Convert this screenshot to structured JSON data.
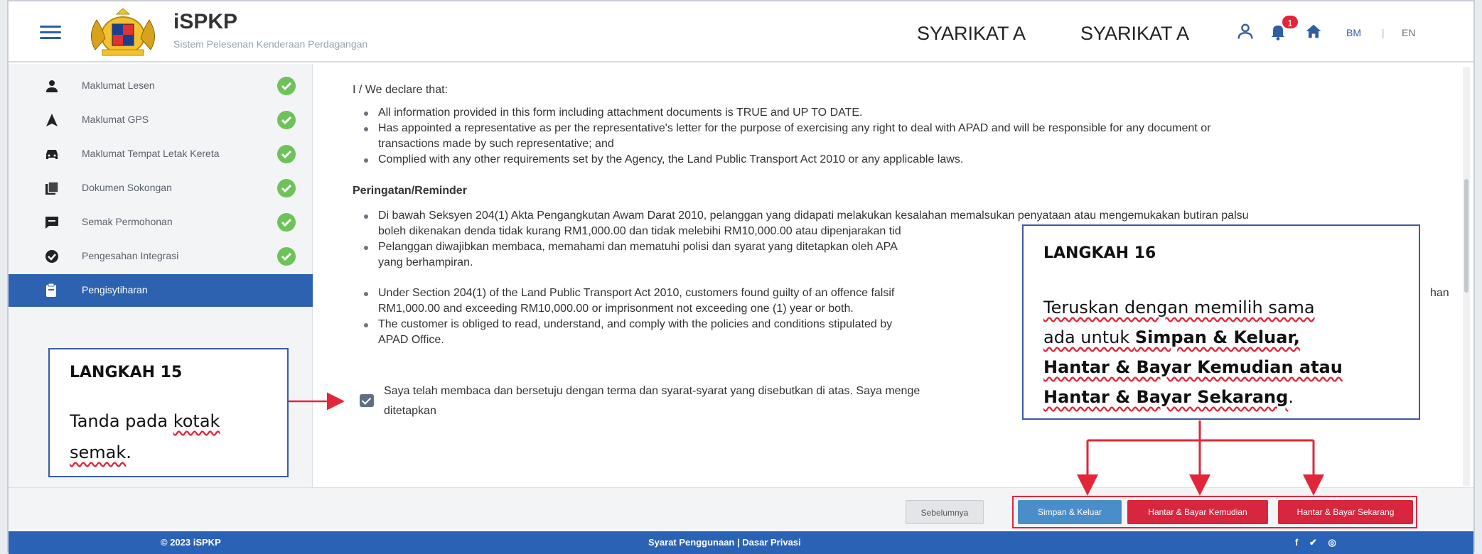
{
  "header": {
    "app_title": "iSPKP",
    "app_subtitle": "Sistem Pelesenan Kenderaan Perdagangan",
    "company_1": "SYARIKAT A",
    "company_2": "SYARIKAT A",
    "notification_count": "1",
    "lang_bm": "BM",
    "lang_sep": "|",
    "lang_en": "EN"
  },
  "sidebar": {
    "items": [
      {
        "label": "Maklumat Lesen",
        "icon": "person-icon",
        "done": true
      },
      {
        "label": "Maklumat GPS",
        "icon": "navigation-icon",
        "done": true
      },
      {
        "label": "Maklumat Tempat Letak Kereta",
        "icon": "car-icon",
        "done": true
      },
      {
        "label": "Dokumen Sokongan",
        "icon": "document-icon",
        "done": true
      },
      {
        "label": "Semak Permohonan",
        "icon": "comment-icon",
        "done": true
      },
      {
        "label": "Pengesahan Integrasi",
        "icon": "verified-icon",
        "done": true
      },
      {
        "label": "Pengisytiharan",
        "icon": "declaration-icon",
        "done": false,
        "active": true
      }
    ]
  },
  "main": {
    "declare_intro": "I / We declare that:",
    "declare_items": [
      "All information provided in this form including attachment documents is TRUE and UP TO DATE.",
      "Has appointed a representative as per the representative's letter for the purpose of exercising any right to deal with APAD and will be responsible for any document or",
      "transactions made by such representative; and",
      "Complied with any other requirements set by the Agency, the Land Public Transport Act 2010 or any applicable laws."
    ],
    "reminder_heading": "Peringatan/Reminder",
    "reminder_items": [
      "Di bawah Seksyen 204(1) Akta Pengangkutan Awam Darat 2010, pelanggan yang didapati melakukan kesalahan memalsukan penyataan atau mengemukakan butiran palsu",
      "boleh dikenakan denda tidak kurang RM1,000.00 dan tidak melebihi RM10,000.00 atau dipenjarakan tid",
      "Pelanggan diwajibkan membaca, memahami dan mematuhi polisi dan syarat yang ditetapkan oleh APA",
      "yang berhampiran.",
      "Under Section 204(1) of the Land Public Transport Act 2010, customers found guilty of an offence falsif",
      "RM1,000.00 and exceeding RM10,000.00 or imprisonment not exceeding one (1) year or both.",
      "The customer is obliged to read, understand, and comply with the policies and conditions stipulated by",
      "APAD Office.",
      "han"
    ],
    "agree_text_1": "Saya telah membaca dan bersetuju dengan terma dan syarat-syarat yang disebutkan di atas. Saya menge",
    "agree_text_2": "ditetapkan",
    "agree_checked": true
  },
  "callout_15": {
    "title": "LANGKAH 15",
    "body_1": "Tanda pada ",
    "body_2": "kotak",
    "body_3": "semak",
    "body_4": "."
  },
  "callout_16": {
    "title": "LANGKAH 16",
    "line1_a": "Teruskan dengan memilih sama",
    "line2_a": "ada untuk ",
    "line2_b": "Simpan & Keluar,",
    "line3": "Hantar & Bayar Kemudian atau",
    "line4_a": "Hantar & Bayar Sekarang",
    "line4_b": "."
  },
  "actions": {
    "prev": "Sebelumnya",
    "save": "Simpan & Keluar",
    "pay_later": "Hantar & Bayar Kemudian",
    "pay_now": "Hantar & Bayar Sekarang"
  },
  "footer": {
    "copyright": "© 2023 iSPKP",
    "terms": "Syarat Penggunaan",
    "sep": " | ",
    "privacy": "Dasar Privasi",
    "social": "f ✔ ◎"
  },
  "colors": {
    "primary": "#2d62b1",
    "danger": "#d7263e",
    "success": "#6ec25a",
    "callout_border": "#3b5ca3"
  }
}
